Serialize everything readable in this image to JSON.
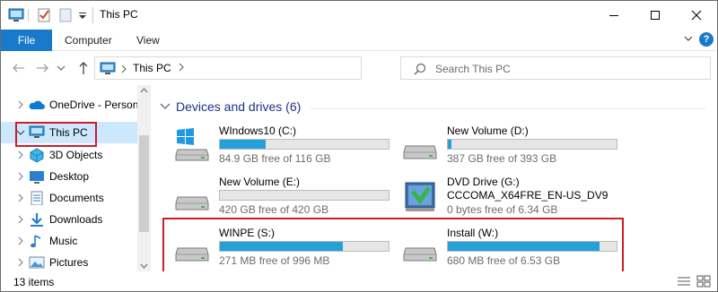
{
  "window": {
    "title": "This PC"
  },
  "ribbon": {
    "file": "File",
    "computer": "Computer",
    "view": "View"
  },
  "address": {
    "crumb": "This PC"
  },
  "search": {
    "placeholder": "Search This PC"
  },
  "nav": {
    "items": [
      {
        "label": "OneDrive - Personal",
        "icon": "onedrive-icon"
      },
      {
        "label": "This PC",
        "icon": "this-pc-icon",
        "selected": true
      },
      {
        "label": "3D Objects",
        "icon": "3d-objects-icon"
      },
      {
        "label": "Desktop",
        "icon": "desktop-folder-icon"
      },
      {
        "label": "Documents",
        "icon": "documents-icon"
      },
      {
        "label": "Downloads",
        "icon": "downloads-icon"
      },
      {
        "label": "Music",
        "icon": "music-icon"
      },
      {
        "label": "Pictures",
        "icon": "pictures-icon"
      }
    ]
  },
  "content": {
    "group_title": "Devices and drives (6)",
    "drives": [
      {
        "name": "WIndows10 (C:)",
        "free": "84.9 GB free of 116 GB",
        "used_fraction": 0.27,
        "icon": "windows-drive-icon"
      },
      {
        "name": "New Volume (D:)",
        "free": "387 GB free of 393 GB",
        "used_fraction": 0.02,
        "icon": "hard-drive-icon"
      },
      {
        "name": "New Volume (E:)",
        "free": "420 GB free of 420 GB",
        "used_fraction": 0.0,
        "icon": "hard-drive-icon"
      },
      {
        "name": "DVD Drive (G:)",
        "sub": "CCCOMA_X64FRE_EN-US_DV9",
        "free": "0 bytes free of 6.34 GB",
        "icon": "dvd-drive-icon"
      },
      {
        "name": "WINPE (S:)",
        "free": "271 MB free of 996 MB",
        "used_fraction": 0.73,
        "icon": "hard-drive-icon"
      },
      {
        "name": "Install (W:)",
        "free": "680 MB free of 6.53 GB",
        "used_fraction": 0.9,
        "icon": "hard-drive-icon"
      }
    ]
  },
  "status": {
    "count": "13 items"
  },
  "colors": {
    "accent": "#1979ca",
    "bar_fill": "#26a0da",
    "highlight_box": "#d01c24",
    "selection": "#cce8ff"
  }
}
